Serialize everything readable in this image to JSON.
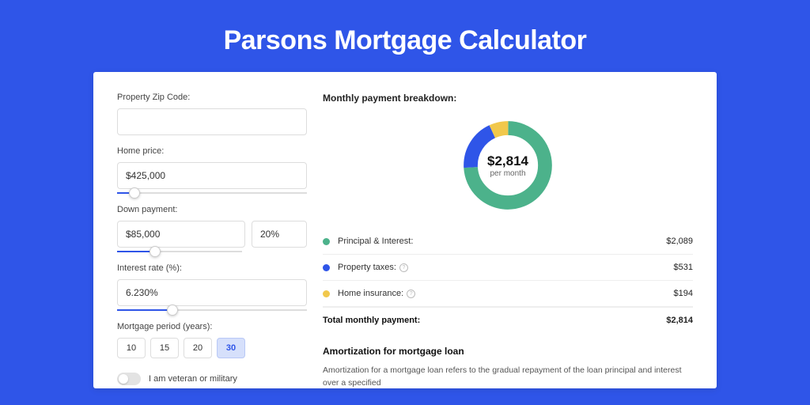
{
  "title": "Parsons Mortgage Calculator",
  "form": {
    "zip": {
      "label": "Property Zip Code:",
      "value": ""
    },
    "home_price": {
      "label": "Home price:",
      "value": "$425,000",
      "slider_pct": 9
    },
    "down_payment": {
      "label": "Down payment:",
      "amount": "$85,000",
      "pct": "20%",
      "slider_pct": 20
    },
    "interest_rate": {
      "label": "Interest rate (%):",
      "value": "6.230%",
      "slider_pct": 29
    },
    "period": {
      "label": "Mortgage period (years):",
      "options": [
        "10",
        "15",
        "20",
        "30"
      ],
      "selected": "30"
    },
    "veteran": {
      "label": "I am veteran or military",
      "on": false
    }
  },
  "breakdown": {
    "heading": "Monthly payment breakdown:",
    "donut_amount": "$2,814",
    "donut_sub": "per month",
    "items": [
      {
        "label": "Principal & Interest:",
        "value": "$2,089",
        "color": "#4cb28b",
        "pct": 74,
        "info": false
      },
      {
        "label": "Property taxes:",
        "value": "$531",
        "color": "#2f55e8",
        "pct": 19,
        "info": true
      },
      {
        "label": "Home insurance:",
        "value": "$194",
        "color": "#f1c84c",
        "pct": 7,
        "info": true
      }
    ],
    "total_label": "Total monthly payment:",
    "total_value": "$2,814"
  },
  "chart_data": {
    "type": "pie",
    "title": "Monthly payment breakdown",
    "categories": [
      "Principal & Interest",
      "Property taxes",
      "Home insurance"
    ],
    "values": [
      2089,
      531,
      194
    ],
    "colors": [
      "#4cb28b",
      "#2f55e8",
      "#f1c84c"
    ],
    "center_label": "$2,814 per month"
  },
  "amort": {
    "title": "Amortization for mortgage loan",
    "text": "Amortization for a mortgage loan refers to the gradual repayment of the loan principal and interest over a specified"
  }
}
